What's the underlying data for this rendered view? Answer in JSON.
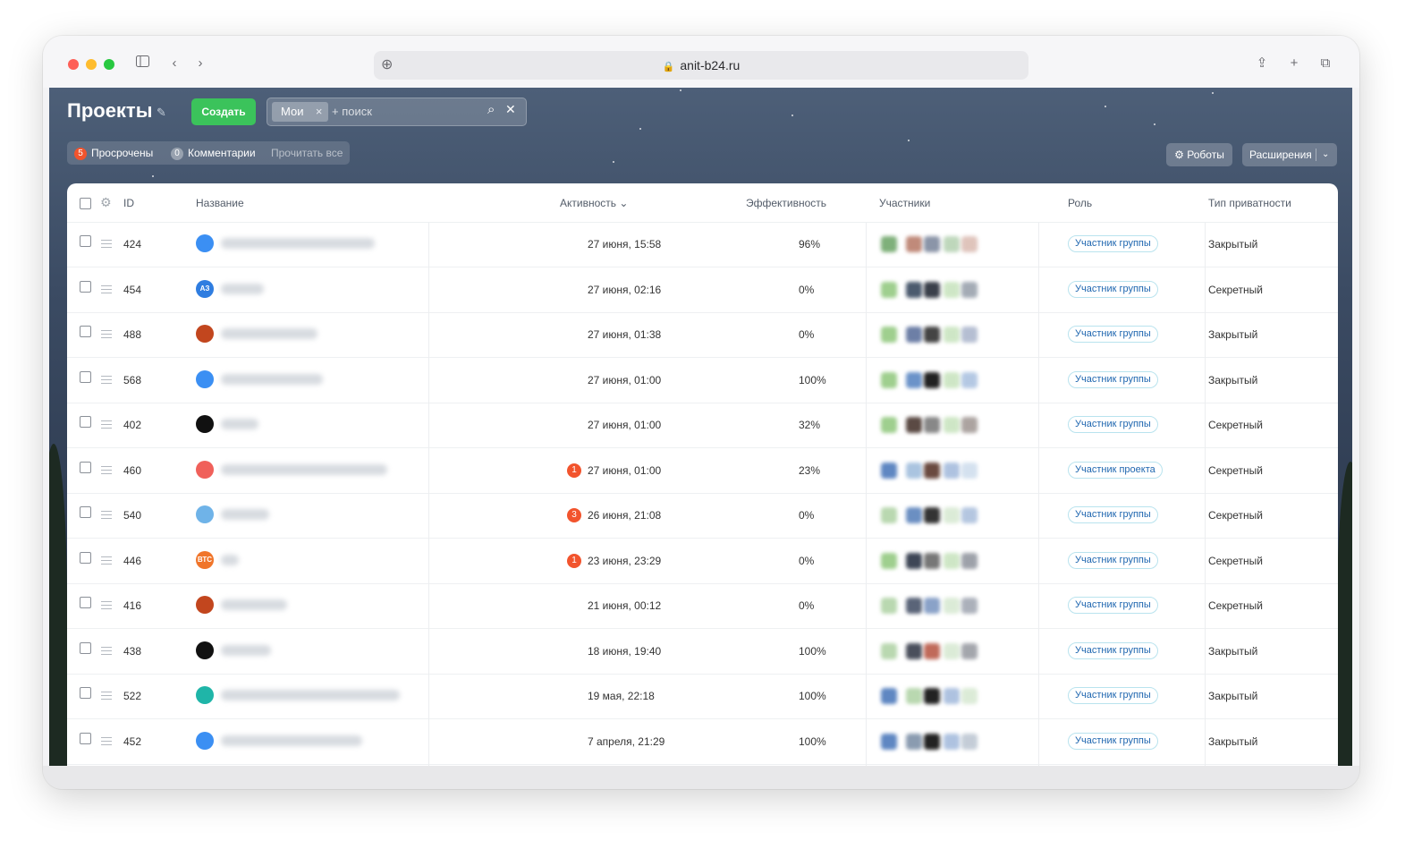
{
  "browser": {
    "url": "anit-b24.ru"
  },
  "header": {
    "title": "Проекты",
    "create_label": "Создать",
    "filter_chip": "Мои",
    "search_placeholder": "+ поиск",
    "robots_label": "Роботы",
    "extensions_label": "Расширения"
  },
  "counters": {
    "overdue_count": "5",
    "overdue_label": "Просрочены",
    "comments_count": "0",
    "comments_label": "Комментарии",
    "read_all_label": "Прочитать все"
  },
  "columns": {
    "id": "ID",
    "name": "Название",
    "activity": "Активность",
    "efficiency": "Эффективность",
    "members": "Участники",
    "role": "Роль",
    "privacy": "Тип приватности"
  },
  "rows": [
    {
      "id": "424",
      "activity": "27 июня, 15:58",
      "badge": "",
      "efficiency": "96%",
      "role": "Участник группы",
      "privacy": "Закрытый",
      "avatar_color": "#3b8ff3",
      "avatar_text": ""
    },
    {
      "id": "454",
      "activity": "27 июня, 02:16",
      "badge": "",
      "efficiency": "0%",
      "role": "Участник группы",
      "privacy": "Секретный",
      "avatar_color": "#2f7de0",
      "avatar_text": "АЗ"
    },
    {
      "id": "488",
      "activity": "27 июня, 01:38",
      "badge": "",
      "efficiency": "0%",
      "role": "Участник группы",
      "privacy": "Закрытый",
      "avatar_color": "#c2461e",
      "avatar_text": ""
    },
    {
      "id": "568",
      "activity": "27 июня, 01:00",
      "badge": "",
      "efficiency": "100%",
      "role": "Участник группы",
      "privacy": "Закрытый",
      "avatar_color": "#3b8ff3",
      "avatar_text": ""
    },
    {
      "id": "402",
      "activity": "27 июня, 01:00",
      "badge": "",
      "efficiency": "32%",
      "role": "Участник группы",
      "privacy": "Секретный",
      "avatar_color": "#111111",
      "avatar_text": ""
    },
    {
      "id": "460",
      "activity": "27 июня, 01:00",
      "badge": "1",
      "efficiency": "23%",
      "role": "Участник проекта",
      "privacy": "Секретный",
      "avatar_color": "#f0605a",
      "avatar_text": ""
    },
    {
      "id": "540",
      "activity": "26 июня, 21:08",
      "badge": "3",
      "efficiency": "0%",
      "role": "Участник группы",
      "privacy": "Секретный",
      "avatar_color": "#6fb3e8",
      "avatar_text": ""
    },
    {
      "id": "446",
      "activity": "23 июня, 23:29",
      "badge": "1",
      "efficiency": "0%",
      "role": "Участник группы",
      "privacy": "Секретный",
      "avatar_color": "#f0752a",
      "avatar_text": "ВТС"
    },
    {
      "id": "416",
      "activity": "21 июня, 00:12",
      "badge": "",
      "efficiency": "0%",
      "role": "Участник группы",
      "privacy": "Секретный",
      "avatar_color": "#c2461e",
      "avatar_text": ""
    },
    {
      "id": "438",
      "activity": "18 июня, 19:40",
      "badge": "",
      "efficiency": "100%",
      "role": "Участник группы",
      "privacy": "Закрытый",
      "avatar_color": "#111111",
      "avatar_text": ""
    },
    {
      "id": "522",
      "activity": "19 мая, 22:18",
      "badge": "",
      "efficiency": "100%",
      "role": "Участник группы",
      "privacy": "Закрытый",
      "avatar_color": "#1fb5a8",
      "avatar_text": ""
    },
    {
      "id": "452",
      "activity": "7 апреля, 21:29",
      "badge": "",
      "efficiency": "100%",
      "role": "Участник группы",
      "privacy": "Закрытый",
      "avatar_color": "#3b8ff3",
      "avatar_text": ""
    }
  ]
}
